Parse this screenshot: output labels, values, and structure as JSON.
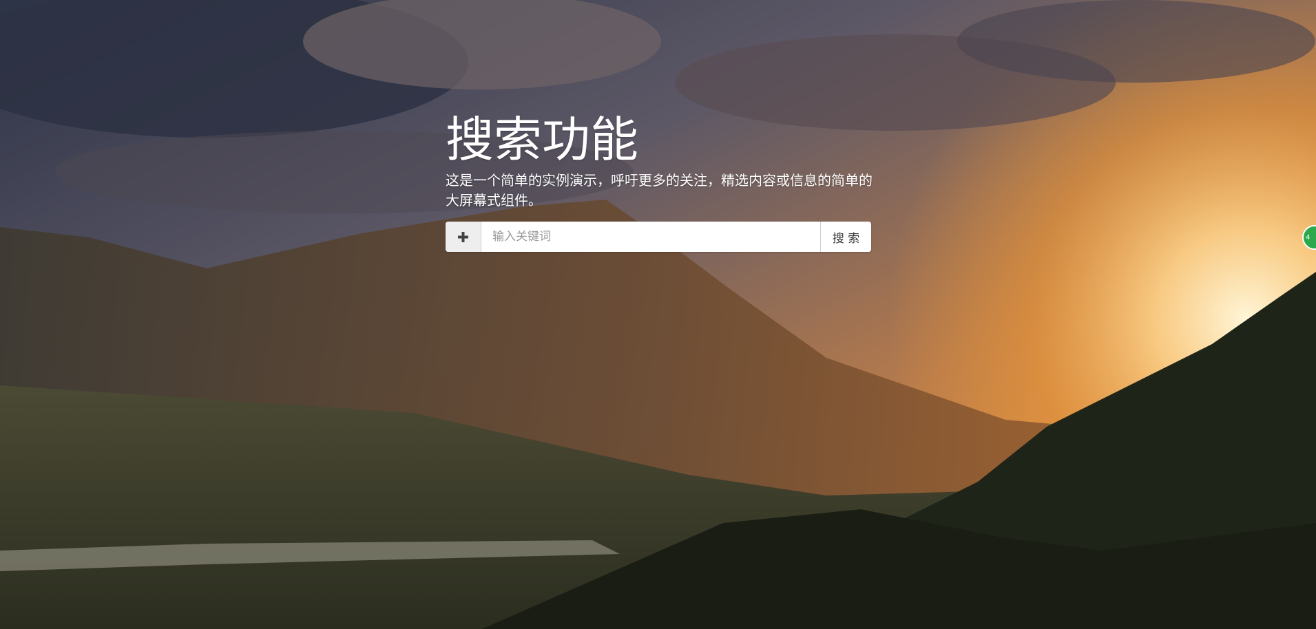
{
  "hero": {
    "title": "搜索功能",
    "subtitle": "这是一个简单的实例演示，呼吁更多的关注，精选内容或信息的简单的大屏幕式组件。"
  },
  "search": {
    "add_icon": "plus-icon",
    "placeholder": "输入关键词",
    "value": "",
    "button_label": "搜 索"
  },
  "side_badge": {
    "label": "4"
  },
  "colors": {
    "text": "#ffffff",
    "addon_bg": "#eeeeee",
    "badge": "#2ea84f"
  }
}
